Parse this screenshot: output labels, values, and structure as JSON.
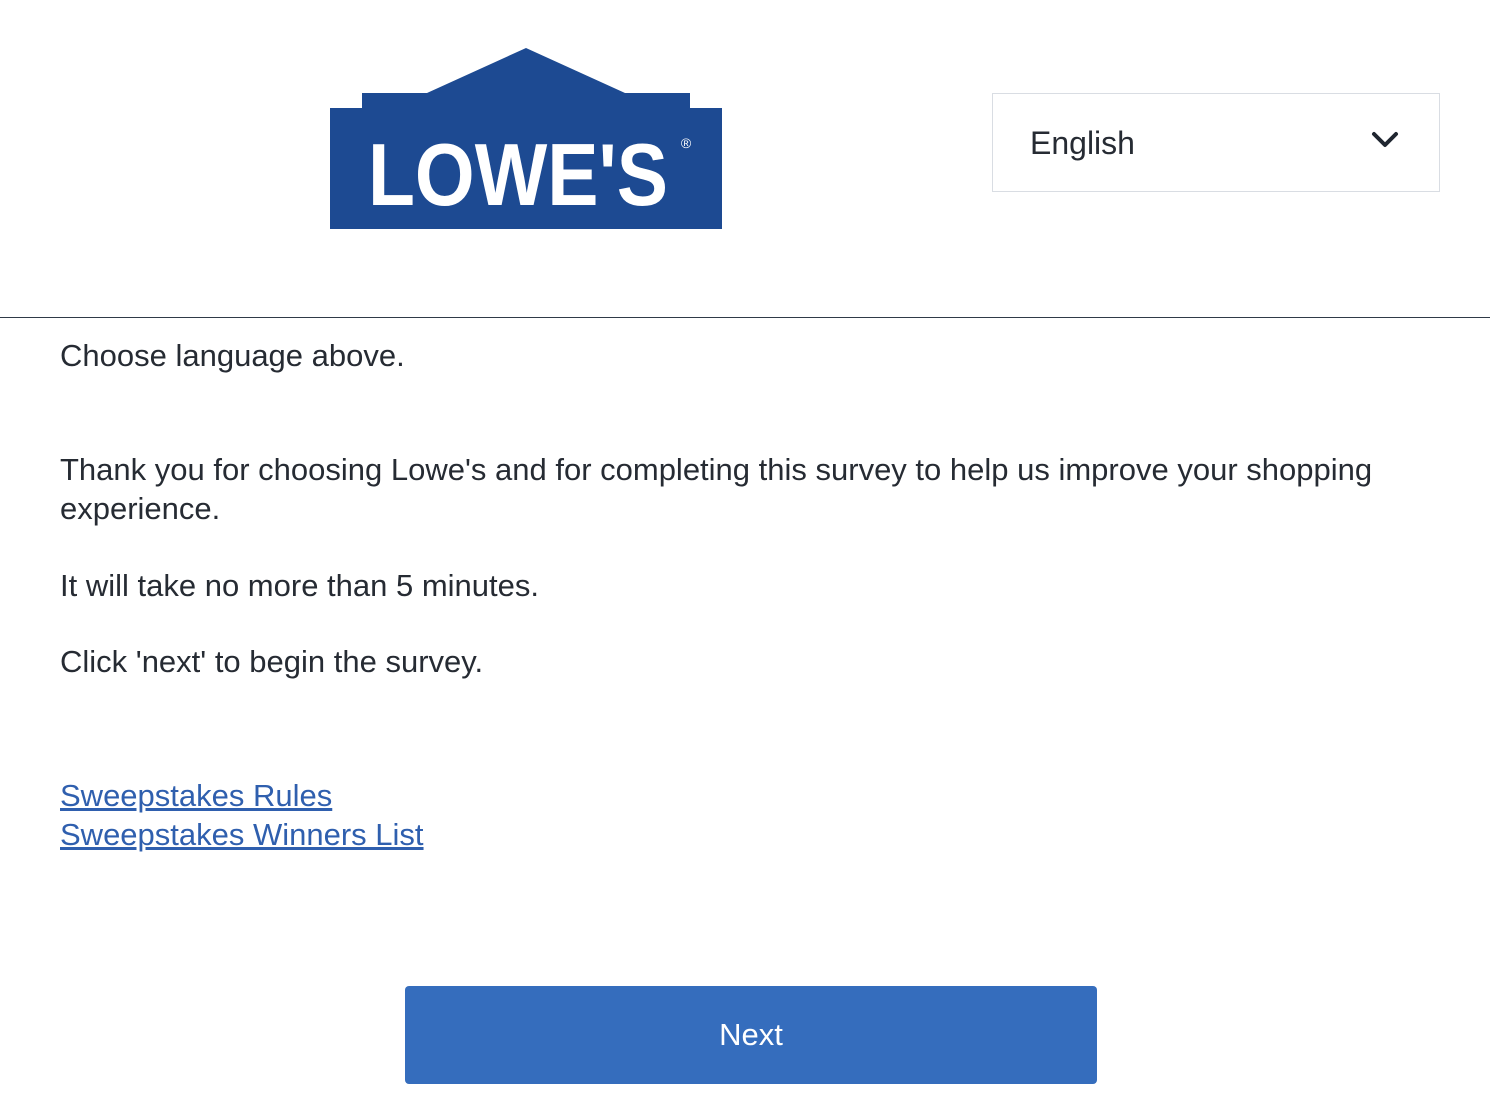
{
  "header": {
    "logo": {
      "text": "LOWE'S",
      "registered_mark": "®",
      "brand_color": "#1d4a92"
    },
    "language_select": {
      "selected": "English",
      "icon": "chevron-down-icon"
    }
  },
  "main": {
    "choose_language": "Choose language above.",
    "thank_you": "Thank you for choosing Lowe's and for completing this survey to help us improve your shopping experience.",
    "duration": "It will take no more than 5 minutes.",
    "instruction": "Click 'next' to begin the survey.",
    "links": {
      "rules": "Sweepstakes Rules",
      "winners": "Sweepstakes Winners List"
    },
    "next_button": "Next"
  },
  "colors": {
    "link": "#2f5fae",
    "button": "#356dbd",
    "text": "#262b33"
  }
}
